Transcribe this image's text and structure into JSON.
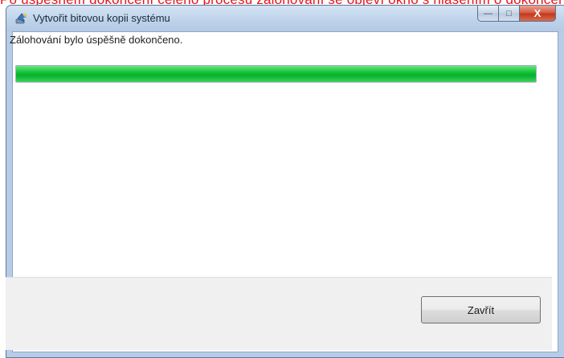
{
  "top_banner": {
    "text": "Po úspěšném dokončení celého procesu zálohování se objeví okno s hlášením o dokončení"
  },
  "window": {
    "title": "Vytvořit bitovou kopii systému",
    "icon": "backup-app-icon",
    "caption_buttons": {
      "minimize": "—",
      "maximize": "□",
      "close": "X"
    }
  },
  "content": {
    "message": "Zálohování bylo úspěšně dokončeno.",
    "progress_percent": 100
  },
  "footer": {
    "close_button_label": "Zavřít"
  },
  "colors": {
    "progress_green": "#13c43a",
    "banner_red": "#e8141c"
  }
}
